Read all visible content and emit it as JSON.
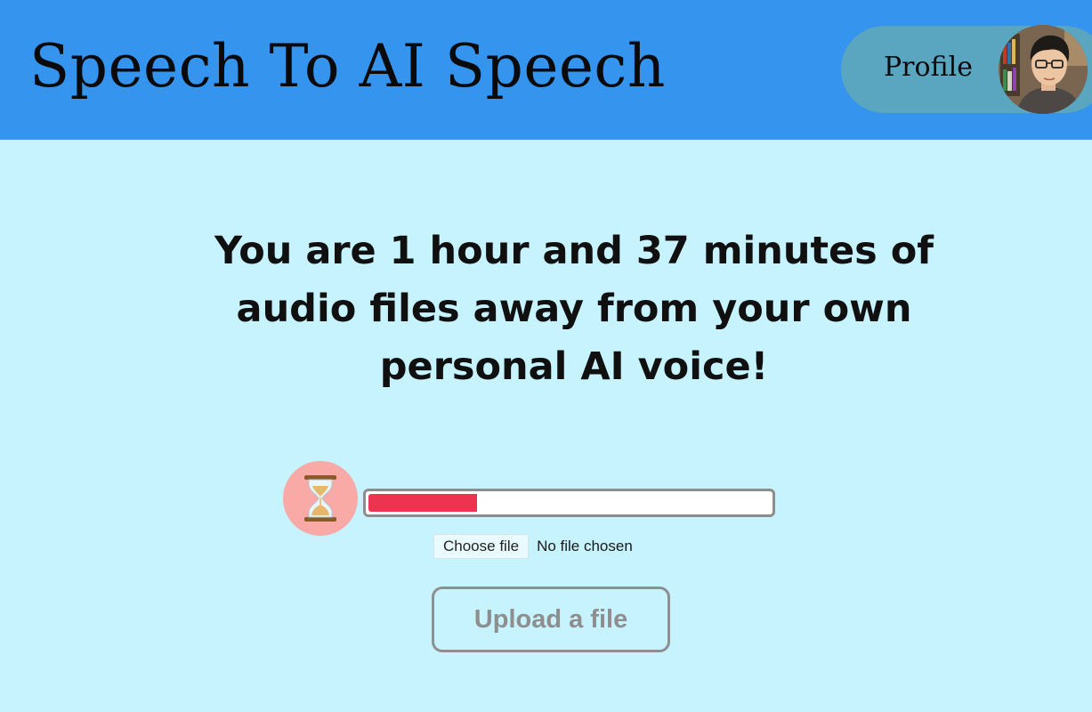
{
  "header": {
    "title": "Speech To AI Speech",
    "profile_label": "Profile",
    "avatar_icon": "user-photo-avatar",
    "colors": {
      "bar": "#3594ed",
      "pill": "#5aa5bf"
    }
  },
  "main": {
    "headline": "You are 1 hour and 37 minutes of audio files away from your own personal AI voice!",
    "progress": {
      "icon": "hourglass-icon",
      "fraction": 0.27,
      "fill_color": "#ec334f"
    },
    "file_input": {
      "button_label": "Choose file",
      "status": "No file chosen"
    },
    "upload_button_label": "Upload a file",
    "background_color": "#c6f3fe"
  }
}
